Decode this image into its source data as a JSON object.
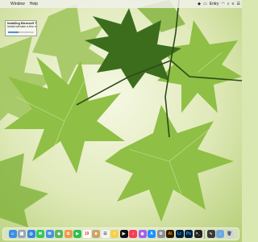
{
  "menubar": {
    "app_menus": [
      "Window",
      "Help"
    ],
    "status": {
      "clock_label": "Entry",
      "icons": [
        "dropbox-icon",
        "battery-icon",
        "wifi-icon",
        "search-icon",
        "control-center-icon",
        "notification-center-icon"
      ]
    }
  },
  "notification": {
    "title": "Installing Microsoft Teams",
    "body": "Install will take a few minutes",
    "progress": 0.4
  },
  "dock": {
    "apps": [
      {
        "name": "finder",
        "color": "#3a8ee6",
        "glyph": "☺"
      },
      {
        "name": "launchpad",
        "color": "#9aa3b5",
        "glyph": "▦"
      },
      {
        "name": "safari",
        "color": "#2e86de",
        "glyph": "◎"
      },
      {
        "name": "messages",
        "color": "#34c759",
        "glyph": "✉"
      },
      {
        "name": "mail",
        "color": "#4a90e2",
        "glyph": "✉"
      },
      {
        "name": "maps",
        "color": "#5cb85c",
        "glyph": "◆"
      },
      {
        "name": "photos",
        "color": "#f2994a",
        "glyph": "✿"
      },
      {
        "name": "facetime",
        "color": "#2dbf4e",
        "glyph": "▶"
      },
      {
        "name": "calendar",
        "color": "#ffffff",
        "glyph": "19",
        "text": "#e33"
      },
      {
        "name": "contacts",
        "color": "#c9a46b",
        "glyph": "☻"
      },
      {
        "name": "reminders",
        "color": "#f5f5f5",
        "glyph": "☰",
        "text": "#555"
      },
      {
        "name": "notes",
        "color": "#f6d04d",
        "glyph": "≡"
      },
      {
        "name": "tv",
        "color": "#111111",
        "glyph": "▶"
      },
      {
        "name": "music",
        "color": "#fa3c55",
        "glyph": "♪"
      },
      {
        "name": "podcasts",
        "color": "#a55eea",
        "glyph": "◉"
      },
      {
        "name": "app-store",
        "color": "#1e90ff",
        "glyph": "A"
      },
      {
        "name": "system-preferences",
        "color": "#8e8e93",
        "glyph": "⚙"
      },
      {
        "name": "illustrator",
        "color": "#2b1a00",
        "glyph": "Ai",
        "text": "#ff9a00"
      },
      {
        "name": "lightroom",
        "color": "#001e36",
        "glyph": "Lr",
        "text": "#31a8ff"
      },
      {
        "name": "photoshop",
        "color": "#001e36",
        "glyph": "Ps",
        "text": "#31a8ff"
      },
      {
        "name": "terminal",
        "color": "#222222",
        "glyph": ">_"
      },
      {
        "name": "activity-monitor",
        "color": "#3a3a3a",
        "glyph": "∿"
      },
      {
        "name": "downloads",
        "color": "#6fa8dc",
        "glyph": "↓"
      },
      {
        "name": "trash",
        "color": "#d0d4d8",
        "glyph": "🗑",
        "text": "#555"
      }
    ]
  }
}
